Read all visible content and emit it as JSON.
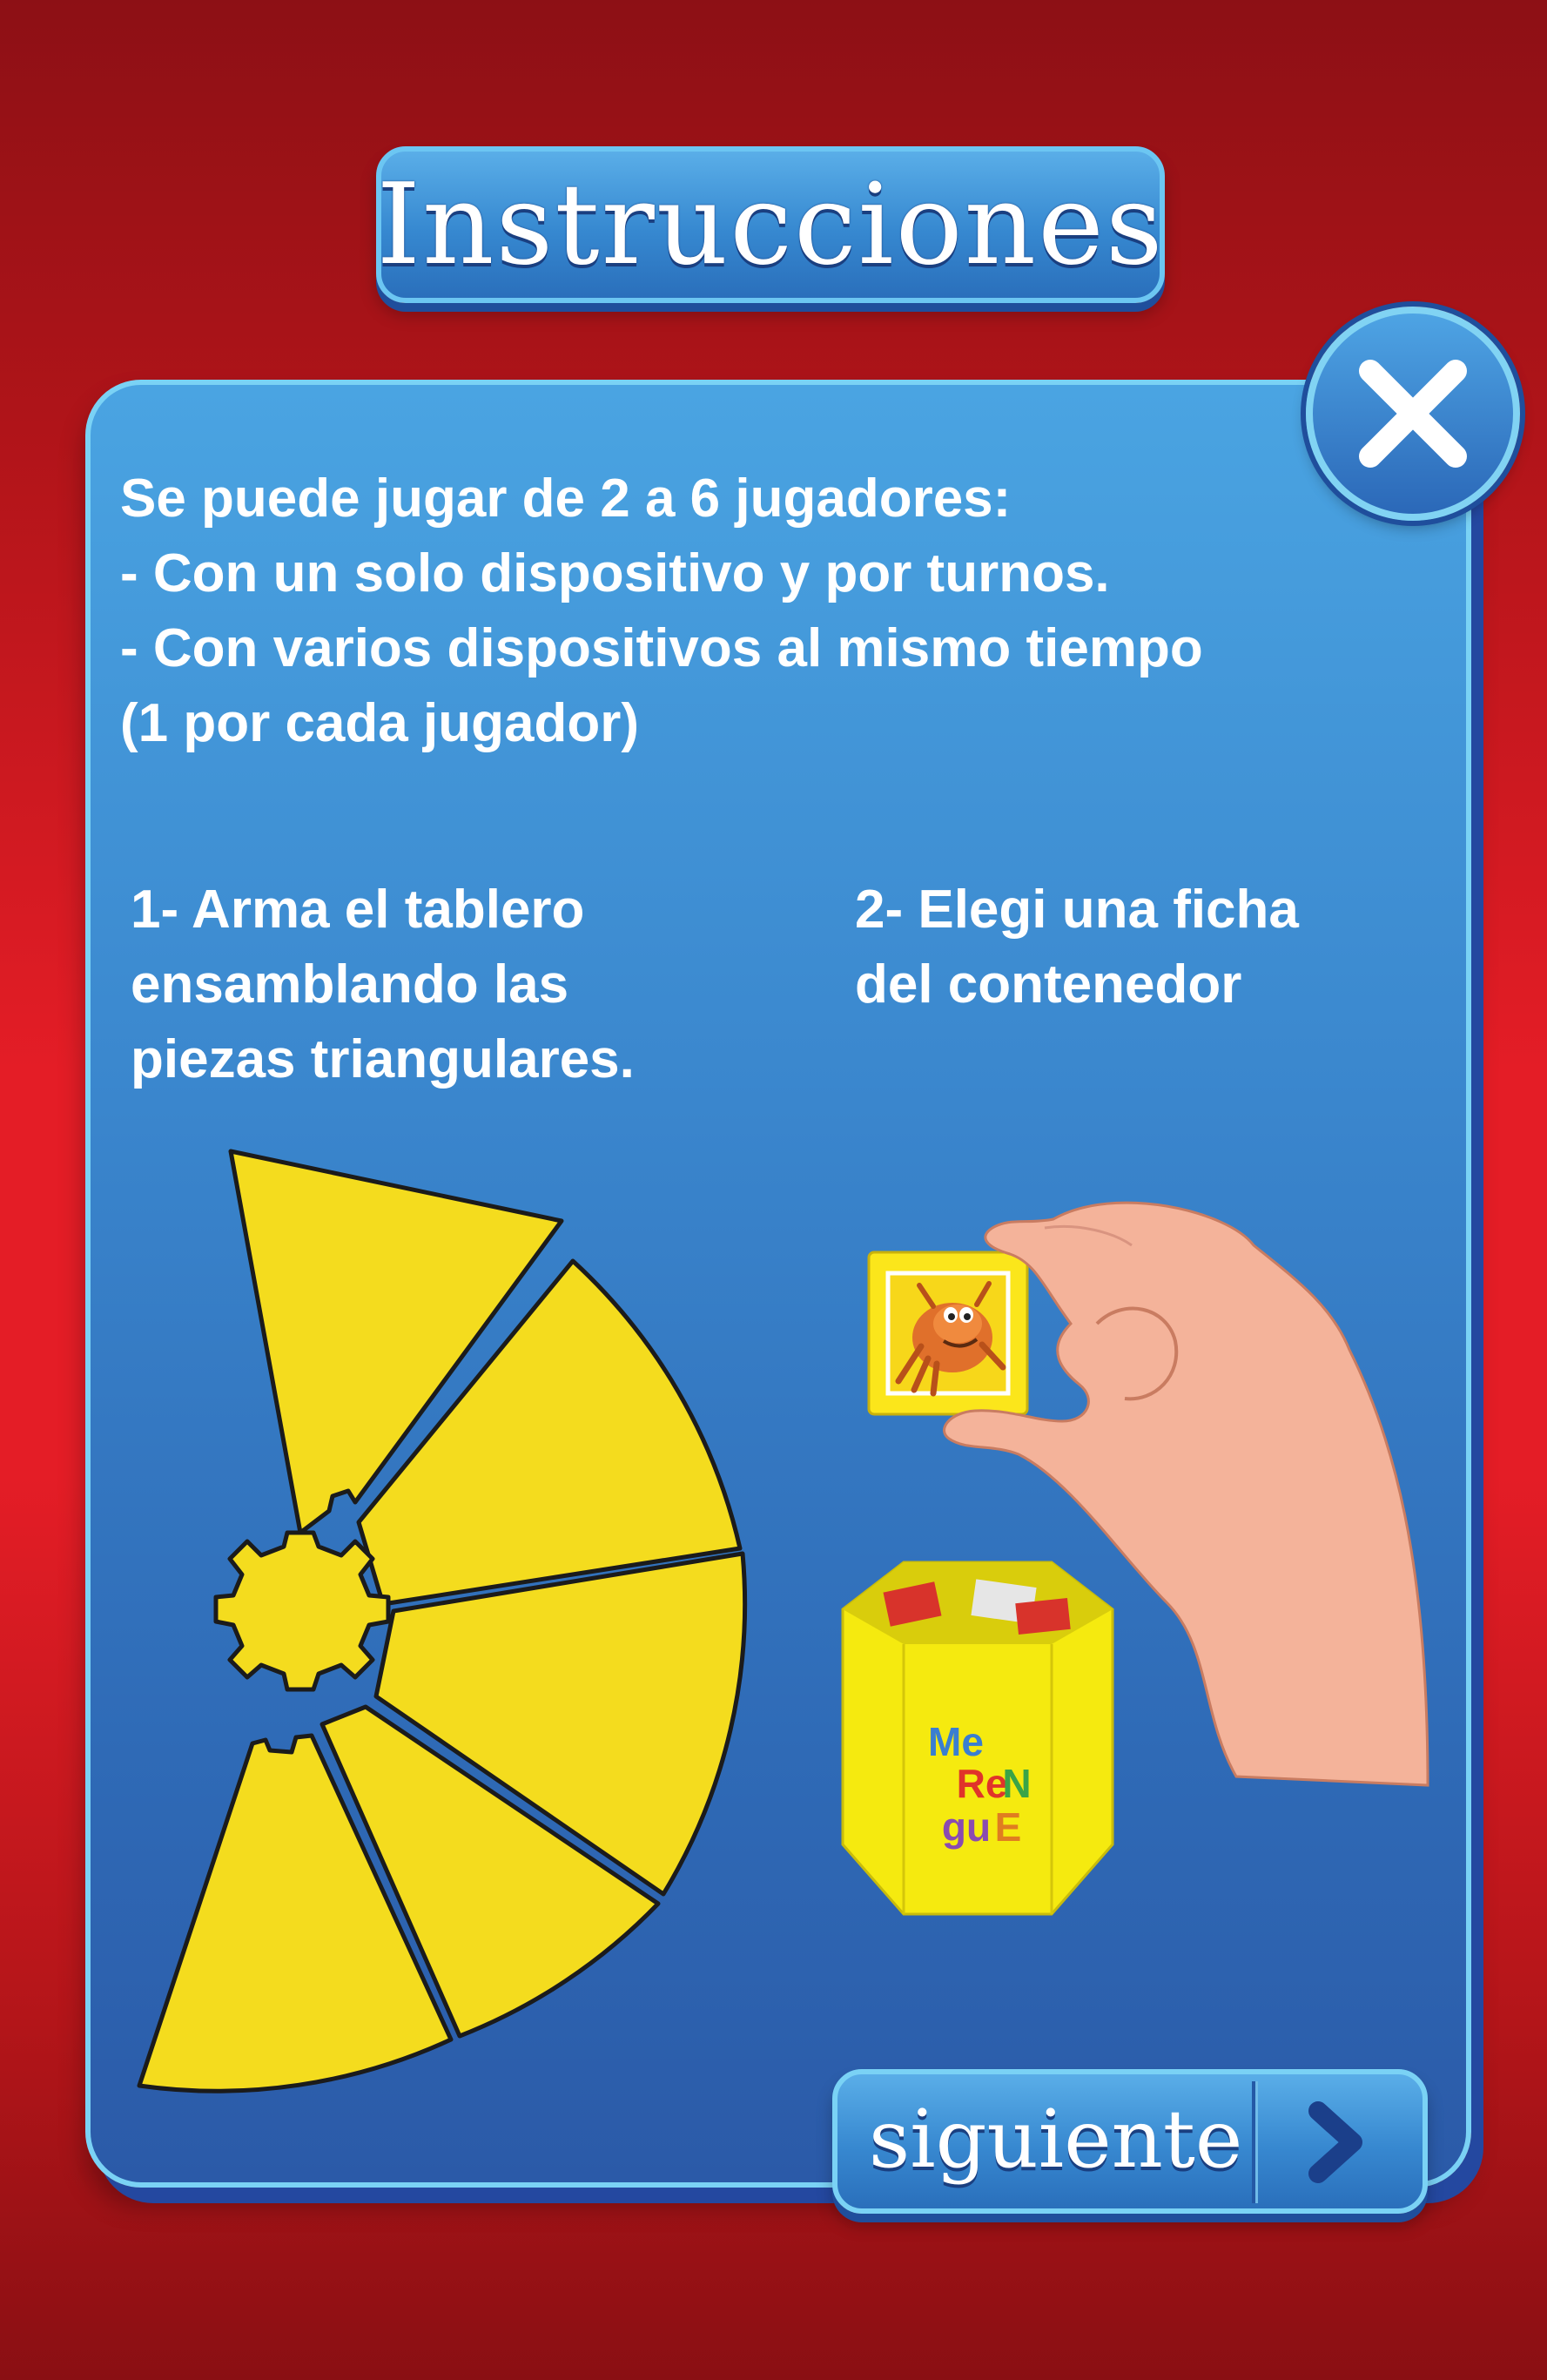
{
  "header": {
    "title": "Instrucciones"
  },
  "panel": {
    "intro_lines": [
      "Se puede jugar de 2 a 6 jugadores:",
      "- Con un solo dispositivo y por turnos.",
      "- Con varios dispositivos al mismo tiempo",
      "(1 por cada jugador)"
    ],
    "step1": "1- Arma el tablero\nensamblando las\npiezas triangulares.",
    "step2": "2- Elegi una ficha\ndel contenedor"
  },
  "container_logo": {
    "lines": [
      "Me",
      "Re",
      "N",
      "gu",
      "E"
    ]
  },
  "buttons": {
    "close_icon": "close-icon",
    "next_label": "siguiente",
    "next_icon": "chevron-right-icon"
  },
  "colors": {
    "background": "#e41d26",
    "panel": "#3a86cd",
    "board": "#f4dc1e",
    "accent_border": "#7ad2f5"
  }
}
